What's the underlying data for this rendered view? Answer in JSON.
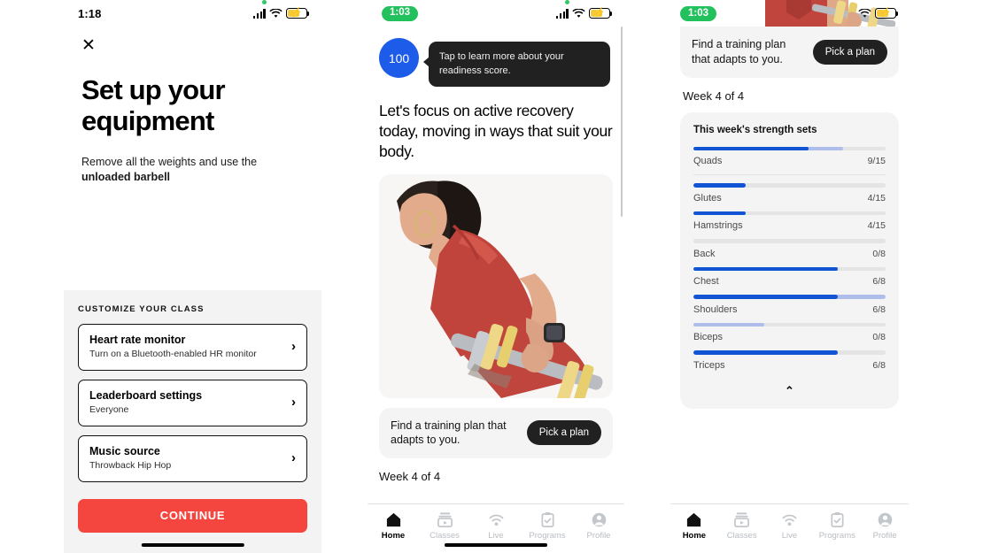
{
  "panel1": {
    "status": {
      "time": "1:18",
      "battery_icon": "battery-charging-icon",
      "wifi_icon": "wifi-icon",
      "signal_icon": "cellular-signal-icon",
      "dot_icon": "recording-dot-icon"
    },
    "close_icon_glyph": "✕",
    "title": "Set up your equipment",
    "subtitle_lead": "Remove all the weights and use the ",
    "subtitle_bold": "unloaded barbell",
    "section_label": "CUSTOMIZE YOUR CLASS",
    "options": [
      {
        "title": "Heart rate monitor",
        "desc": "Turn on a Bluetooth-enabled HR monitor",
        "chevron": "›"
      },
      {
        "title": "Leaderboard settings",
        "desc": "Everyone",
        "chevron": "›"
      },
      {
        "title": "Music source",
        "desc": "Throwback Hip Hop",
        "chevron": "›"
      }
    ],
    "continue_label": "CONTINUE",
    "accent_color": "#f4453f"
  },
  "panel2": {
    "status": {
      "time_pill": "1:03",
      "pill_color": "#22c15e"
    },
    "readiness_score": "100",
    "score_color": "#1d5ce8",
    "tooltip": "Tap to learn more about your readiness score.",
    "headline": "Let's focus on active recovery today, moving in ways that suit your body.",
    "photo_alt": "woman-lifting-barbell-photo",
    "plan_card": {
      "text": "Find a training plan that adapts to you.",
      "button": "Pick a plan"
    },
    "week_label": "Week 4 of 4",
    "nav": [
      {
        "label": "Home",
        "icon": "home-icon",
        "active": true
      },
      {
        "label": "Classes",
        "icon": "classes-icon",
        "active": false
      },
      {
        "label": "Live",
        "icon": "live-wifi-icon",
        "active": false
      },
      {
        "label": "Programs",
        "icon": "programs-clipboard-icon",
        "active": false
      },
      {
        "label": "Profile",
        "icon": "profile-person-icon",
        "active": false
      }
    ]
  },
  "panel3": {
    "status": {
      "time_pill": "1:03",
      "pill_color": "#22c15e"
    },
    "plan_card": {
      "text": "Find a training plan that adapts to you.",
      "button": "Pick a plan"
    },
    "week_label": "Week 4 of 4",
    "sets_title": "This week's strength sets",
    "collapse_icon_glyph": "⌃",
    "bar_colors": {
      "solid": "#1155d4",
      "light": "#aebdea",
      "track": "#e4e4e4"
    },
    "sets": [
      {
        "name": "Quads",
        "count": "9/15",
        "solid_pct": 60,
        "light_pct": 78
      },
      {
        "name": "Glutes",
        "count": "4/15",
        "solid_pct": 27,
        "light_pct": 27
      },
      {
        "name": "Hamstrings",
        "count": "4/15",
        "solid_pct": 27,
        "light_pct": 27
      },
      {
        "name": "Back",
        "count": "0/8",
        "solid_pct": 0,
        "light_pct": 0
      },
      {
        "name": "Chest",
        "count": "6/8",
        "solid_pct": 75,
        "light_pct": 75
      },
      {
        "name": "Shoulders",
        "count": "6/8",
        "solid_pct": 75,
        "light_pct": 100
      },
      {
        "name": "Biceps",
        "count": "0/8",
        "solid_pct": 0,
        "light_pct": 37
      },
      {
        "name": "Triceps",
        "count": "6/8",
        "solid_pct": 75,
        "light_pct": 75
      }
    ],
    "nav": [
      {
        "label": "Home",
        "icon": "home-icon",
        "active": true
      },
      {
        "label": "Classes",
        "icon": "classes-icon",
        "active": false
      },
      {
        "label": "Live",
        "icon": "live-wifi-icon",
        "active": false
      },
      {
        "label": "Programs",
        "icon": "programs-clipboard-icon",
        "active": false
      },
      {
        "label": "Profile",
        "icon": "profile-person-icon",
        "active": false
      }
    ]
  }
}
